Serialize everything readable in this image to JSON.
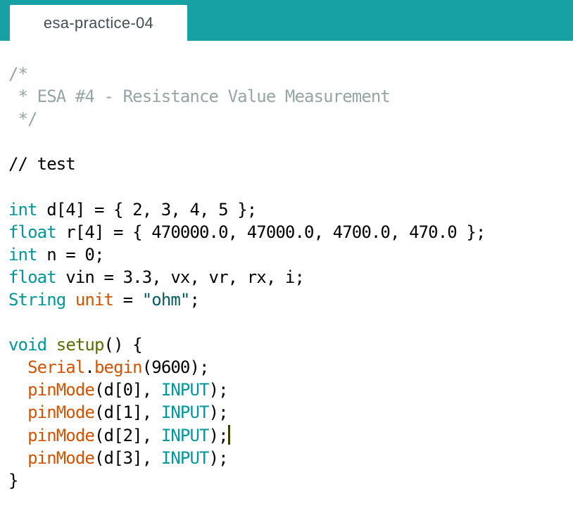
{
  "tab": {
    "label": "esa-practice-04"
  },
  "code": {
    "lines": [
      [
        {
          "t": "/*",
          "c": "comment"
        }
      ],
      [
        {
          "t": " * ESA #4 - Resistance Value Measurement",
          "c": "comment"
        }
      ],
      [
        {
          "t": " */",
          "c": "comment"
        }
      ],
      [],
      [
        {
          "t": "// test",
          "c": "plain"
        }
      ],
      [],
      [
        {
          "t": "int",
          "c": "type"
        },
        {
          "t": " d[4] = { 2, 3, 4, 5 };",
          "c": "plain"
        }
      ],
      [
        {
          "t": "float",
          "c": "type"
        },
        {
          "t": " r[4] = { 470000.0, 47000.0, 4700.0, 470.0 };",
          "c": "plain"
        }
      ],
      [
        {
          "t": "int",
          "c": "type"
        },
        {
          "t": " n = 0;",
          "c": "plain"
        }
      ],
      [
        {
          "t": "float",
          "c": "type"
        },
        {
          "t": " vin = 3.3, vx, vr, rx, i;",
          "c": "plain"
        }
      ],
      [
        {
          "t": "String",
          "c": "type"
        },
        {
          "t": " ",
          "c": "plain"
        },
        {
          "t": "unit",
          "c": "func"
        },
        {
          "t": " = ",
          "c": "plain"
        },
        {
          "t": "\"ohm\"",
          "c": "string"
        },
        {
          "t": ";",
          "c": "plain"
        }
      ],
      [],
      [
        {
          "t": "void",
          "c": "type"
        },
        {
          "t": " ",
          "c": "plain"
        },
        {
          "t": "setup",
          "c": "setup"
        },
        {
          "t": "() {",
          "c": "plain"
        }
      ],
      [
        {
          "t": "  ",
          "c": "plain"
        },
        {
          "t": "Serial",
          "c": "func"
        },
        {
          "t": ".",
          "c": "plain"
        },
        {
          "t": "begin",
          "c": "func"
        },
        {
          "t": "(9600);",
          "c": "plain"
        }
      ],
      [
        {
          "t": "  ",
          "c": "plain"
        },
        {
          "t": "pinMode",
          "c": "func"
        },
        {
          "t": "(d[0], ",
          "c": "plain"
        },
        {
          "t": "INPUT",
          "c": "const"
        },
        {
          "t": ");",
          "c": "plain"
        }
      ],
      [
        {
          "t": "  ",
          "c": "plain"
        },
        {
          "t": "pinMode",
          "c": "func"
        },
        {
          "t": "(d[1], ",
          "c": "plain"
        },
        {
          "t": "INPUT",
          "c": "const"
        },
        {
          "t": ");",
          "c": "plain"
        }
      ],
      [
        {
          "t": "  ",
          "c": "plain"
        },
        {
          "t": "pinMode",
          "c": "func"
        },
        {
          "t": "(d[2], ",
          "c": "plain"
        },
        {
          "t": "INPUT",
          "c": "const"
        },
        {
          "t": ");",
          "c": "plain"
        },
        {
          "t": "",
          "c": "cursor"
        }
      ],
      [
        {
          "t": "  ",
          "c": "plain"
        },
        {
          "t": "pinMode",
          "c": "func"
        },
        {
          "t": "(d[3], ",
          "c": "plain"
        },
        {
          "t": "INPUT",
          "c": "const"
        },
        {
          "t": ");",
          "c": "plain"
        }
      ],
      [
        {
          "t": "}",
          "c": "plain"
        }
      ]
    ]
  },
  "colors": {
    "tabbar": "#17a1a5",
    "comment": "#95a5a6",
    "type": "#00979c",
    "function": "#d35400",
    "setup": "#5e6d03",
    "string": "#005c5f",
    "cursor": "#3b3b00"
  }
}
